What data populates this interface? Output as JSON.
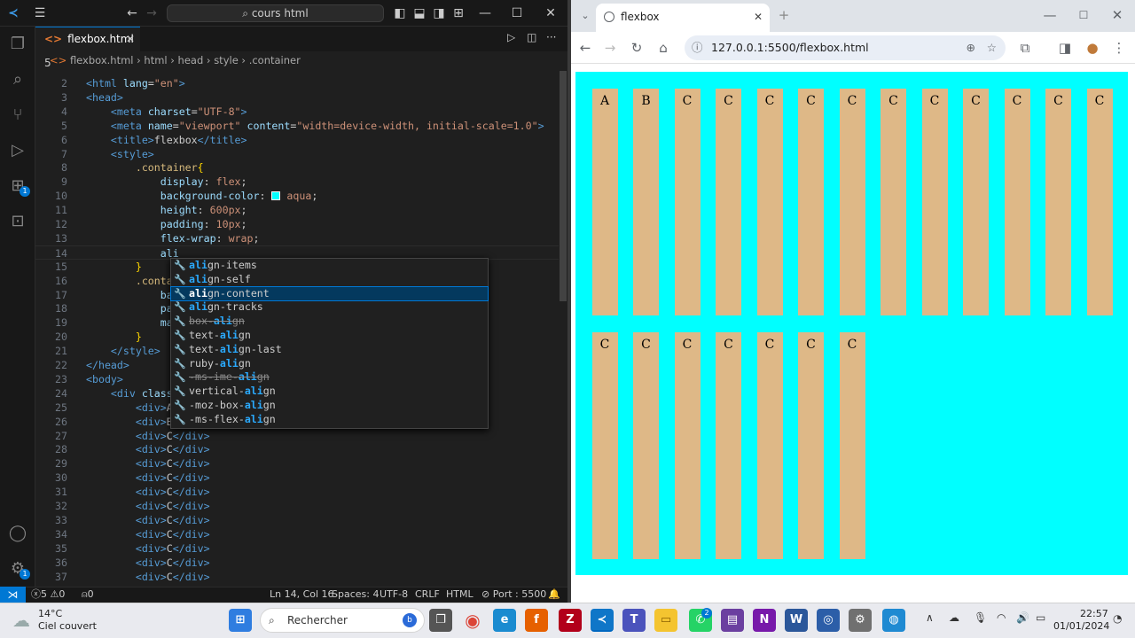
{
  "vscode": {
    "search_label": "cours html",
    "tab_label": "flexbox.html",
    "tab_suffix": "5",
    "breadcrumb": [
      "flexbox.html",
      "html",
      "head",
      "style",
      ".container"
    ],
    "code_lines": [
      {
        "n": "2",
        "html": "<span class='tg'>&lt;html</span> <span class='at'>lang</span>=<span class='st'>\"en\"</span><span class='tg'>&gt;</span>"
      },
      {
        "n": "3",
        "html": "<span class='tg'>&lt;head&gt;</span>"
      },
      {
        "n": "4",
        "html": "    <span class='tg'>&lt;meta</span> <span class='at'>charset</span>=<span class='st'>\"UTF-8\"</span><span class='tg'>&gt;</span>"
      },
      {
        "n": "5",
        "html": "    <span class='tg'>&lt;meta</span> <span class='at'>name</span>=<span class='st'>\"viewport\"</span> <span class='at'>content</span>=<span class='st'>\"width=device-width, initial-scale=1.0\"</span><span class='tg'>&gt;</span>"
      },
      {
        "n": "6",
        "html": "    <span class='tg'>&lt;title&gt;</span>flexbox<span class='tg'>&lt;/title&gt;</span>"
      },
      {
        "n": "7",
        "html": "    <span class='tg'>&lt;style&gt;</span>"
      },
      {
        "n": "8",
        "html": "        <span class='sel'>.container</span><span class='yb'>{</span>"
      },
      {
        "n": "9",
        "html": "            <span class='pr'>display</span>: <span class='vl'>flex</span>;"
      },
      {
        "n": "10",
        "html": "            <span class='pr'>background-color</span>: <span style='display:inline-block;width:10px;height:10px;background:#00ffff;border:1px solid #fff;vertical-align:-1px'></span> <span class='vl'>aqua</span>;"
      },
      {
        "n": "11",
        "html": "            <span class='pr'>height</span>: <span class='vl'>600px</span>;"
      },
      {
        "n": "12",
        "html": "            <span class='pr'>padding</span>: <span class='vl'>10px</span>;"
      },
      {
        "n": "13",
        "html": "            <span class='pr'>flex-wrap</span>: <span class='vl'>wrap</span>;"
      },
      {
        "n": "14",
        "html": "            <span class='pr'>ali</span>"
      },
      {
        "n": "15",
        "html": "        <span class='yb'>}</span>"
      },
      {
        "n": "16",
        "html": "        <span class='sel'>.contai</span>"
      },
      {
        "n": "17",
        "html": "            <span class='pr'>bac</span>"
      },
      {
        "n": "18",
        "html": "            <span class='pr'>pad</span>"
      },
      {
        "n": "19",
        "html": "            <span class='pr'>mar</span>"
      },
      {
        "n": "20",
        "html": "        <span class='yb'>}</span>"
      },
      {
        "n": "21",
        "html": "    <span class='tg'>&lt;/style&gt;</span>"
      },
      {
        "n": "22",
        "html": "<span class='tg'>&lt;/head&gt;</span>"
      },
      {
        "n": "23",
        "html": "<span class='tg'>&lt;body&gt;</span>"
      },
      {
        "n": "24",
        "html": "    <span class='tg'>&lt;div</span> <span class='at'>class</span>="
      },
      {
        "n": "25",
        "html": "        <span class='tg'>&lt;div&gt;</span>A<span class='tg'>&lt;</span>"
      },
      {
        "n": "26",
        "html": "        <span class='tg'>&lt;div&gt;</span>B<span class='tg'>&lt;</span>"
      },
      {
        "n": "27",
        "html": "        <span class='tg'>&lt;div&gt;</span>C<span class='tg'>&lt;/div&gt;</span>"
      },
      {
        "n": "28",
        "html": "        <span class='tg'>&lt;div&gt;</span>C<span class='tg'>&lt;/div&gt;</span>"
      },
      {
        "n": "29",
        "html": "        <span class='tg'>&lt;div&gt;</span>C<span class='tg'>&lt;/div&gt;</span>"
      },
      {
        "n": "30",
        "html": "        <span class='tg'>&lt;div&gt;</span>C<span class='tg'>&lt;/div&gt;</span>"
      },
      {
        "n": "31",
        "html": "        <span class='tg'>&lt;div&gt;</span>C<span class='tg'>&lt;/div&gt;</span>"
      },
      {
        "n": "32",
        "html": "        <span class='tg'>&lt;div&gt;</span>C<span class='tg'>&lt;/div&gt;</span>"
      },
      {
        "n": "33",
        "html": "        <span class='tg'>&lt;div&gt;</span>C<span class='tg'>&lt;/div&gt;</span>"
      },
      {
        "n": "34",
        "html": "        <span class='tg'>&lt;div&gt;</span>C<span class='tg'>&lt;/div&gt;</span>"
      },
      {
        "n": "35",
        "html": "        <span class='tg'>&lt;div&gt;</span>C<span class='tg'>&lt;/div&gt;</span>"
      },
      {
        "n": "36",
        "html": "        <span class='tg'>&lt;div&gt;</span>C<span class='tg'>&lt;/div&gt;</span>"
      },
      {
        "n": "37",
        "html": "        <span class='tg'>&lt;div&gt;</span>C<span class='tg'>&lt;/div&gt;</span>"
      }
    ],
    "suggestions": [
      {
        "pre": "",
        "match": "ali",
        "post": "gn-items",
        "state": ""
      },
      {
        "pre": "",
        "match": "ali",
        "post": "gn-self",
        "state": ""
      },
      {
        "pre": "",
        "match": "ali",
        "post": "gn-content",
        "state": "active"
      },
      {
        "pre": "",
        "match": "ali",
        "post": "gn-tracks",
        "state": ""
      },
      {
        "pre": "box-",
        "match": "ali",
        "post": "gn",
        "state": "dep"
      },
      {
        "pre": "text-",
        "match": "ali",
        "post": "gn",
        "state": ""
      },
      {
        "pre": "text-",
        "match": "ali",
        "post": "gn-last",
        "state": ""
      },
      {
        "pre": "ruby-",
        "match": "ali",
        "post": "gn",
        "state": ""
      },
      {
        "pre": "-ms-ime-",
        "match": "ali",
        "post": "gn",
        "state": "dep"
      },
      {
        "pre": "vertical-",
        "match": "ali",
        "post": "gn",
        "state": ""
      },
      {
        "pre": "-moz-box-",
        "match": "ali",
        "post": "gn",
        "state": ""
      },
      {
        "pre": "-ms-flex-",
        "match": "ali",
        "post": "gn",
        "state": ""
      }
    ],
    "status": {
      "errors": "5",
      "warnings": "0",
      "ports": "0",
      "position": "Ln 14, Col 16",
      "spaces": "Spaces: 4",
      "encoding": "UTF-8",
      "eol": "CRLF",
      "language": "HTML",
      "port": "Port : 5500"
    },
    "extensions_badge": "1",
    "settings_badge": "1"
  },
  "browser": {
    "tab_title": "flexbox",
    "url": "127.0.0.1:5500/flexbox.html",
    "flex_color": "#00ffff",
    "item_color": "#deb887",
    "row1": [
      "A",
      "B",
      "C",
      "C",
      "C",
      "C",
      "C",
      "C",
      "C",
      "C",
      "C",
      "C",
      "C"
    ],
    "row2": [
      "C",
      "C",
      "C",
      "C",
      "C",
      "C",
      "C"
    ]
  },
  "taskbar": {
    "weather_temp": "14°C",
    "weather_desc": "Ciel couvert",
    "search_label": "Rechercher",
    "whatsapp_badge": "2",
    "time": "22:57",
    "date": "01/01/2024"
  }
}
